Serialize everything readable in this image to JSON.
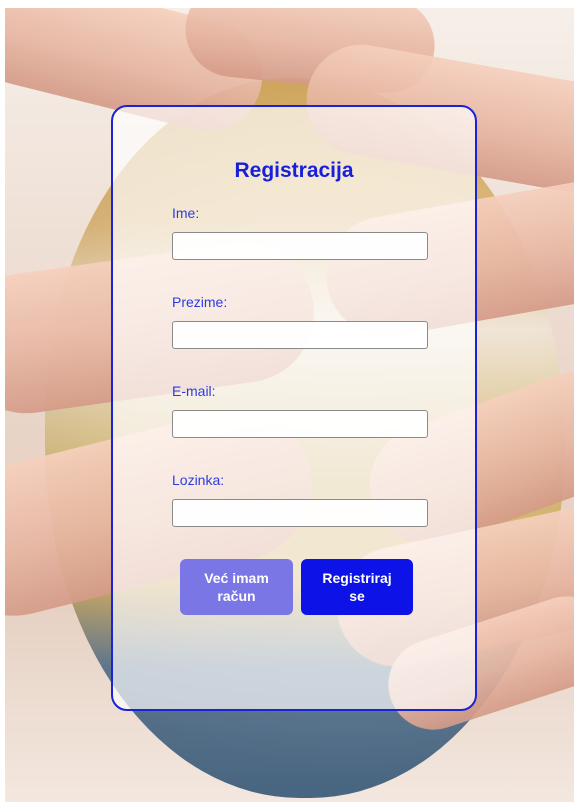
{
  "form": {
    "title": "Registracija",
    "fields": [
      {
        "label": "Ime:",
        "value": "",
        "placeholder": ""
      },
      {
        "label": "Prezime:",
        "value": "",
        "placeholder": ""
      },
      {
        "label": "E-mail:",
        "value": "",
        "placeholder": ""
      },
      {
        "label": "Lozinka:",
        "value": "",
        "placeholder": ""
      }
    ],
    "buttons": {
      "have_account": "Već imam\nračun",
      "register": "Registriraj\nse"
    }
  },
  "colors": {
    "accent": "#1b23d6",
    "primary_button": "#0d12e6",
    "secondary_button": "#7b76e6"
  }
}
